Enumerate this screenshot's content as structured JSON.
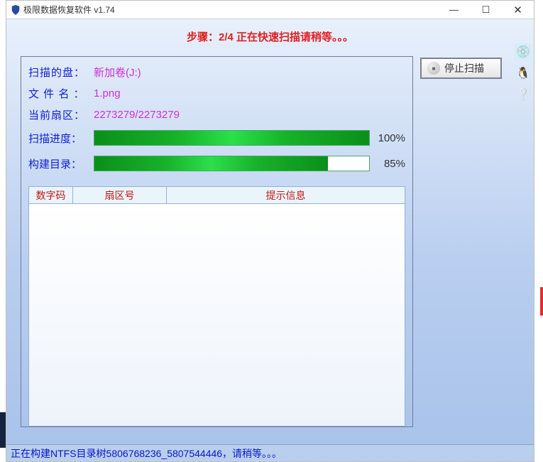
{
  "window": {
    "title": "极限数据恢复软件 v1.74"
  },
  "banner": "步骤：2/4 正在快速扫描请稍等。。。",
  "stop_button": "停止扫描",
  "labels": {
    "disk": "扫描的盘：",
    "filename": "文 件 名 ：",
    "sector": "当前扇区：",
    "scan_progress": "扫描进度：",
    "build_dir": "构建目录："
  },
  "values": {
    "disk": "新加卷(J:)",
    "filename": "1.png",
    "sector": "2273279/2273279"
  },
  "progress": {
    "scan_pct": "100%",
    "scan_width": "100%",
    "build_pct": "85%",
    "build_width": "85%"
  },
  "table": {
    "col1": "数字码",
    "col2": "扇区号",
    "col3": "提示信息"
  },
  "status": "正在构建NTFS目录树5806768236_5807544446，请稍等。。。",
  "sidebar_icons": {
    "i1": "💿",
    "i2": "🐧",
    "i3": "❔"
  }
}
